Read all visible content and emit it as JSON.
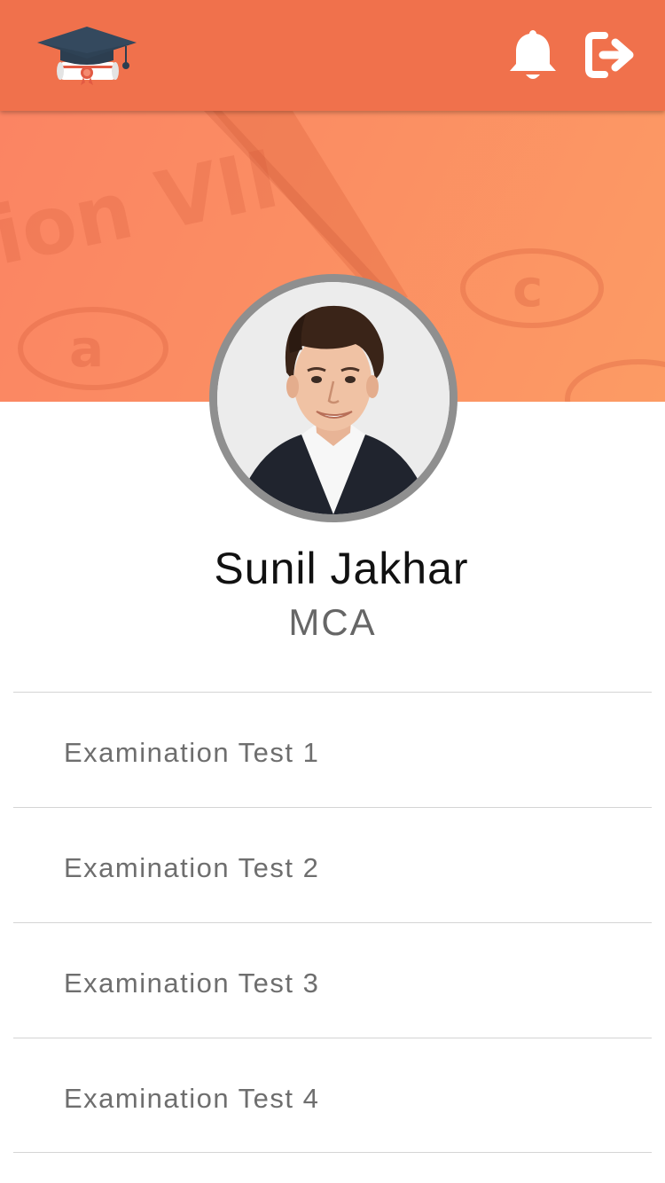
{
  "header": {
    "logo_icon": "graduation-cap-diploma-icon",
    "notification_icon": "bell-icon",
    "logout_icon": "sign-out-icon",
    "brand_color": "#f0714c"
  },
  "banner": {
    "background_colors": [
      "#fb8463",
      "#fc9b64"
    ],
    "watermark_text": "ion VII",
    "watermark_option_a": "a",
    "watermark_option_c": "c"
  },
  "profile": {
    "name": "Sunil Jakhar",
    "course": "MCA"
  },
  "tests": [
    {
      "label": "Examination Test 1"
    },
    {
      "label": "Examination Test 2"
    },
    {
      "label": "Examination Test 3"
    },
    {
      "label": "Examination Test 4"
    }
  ]
}
